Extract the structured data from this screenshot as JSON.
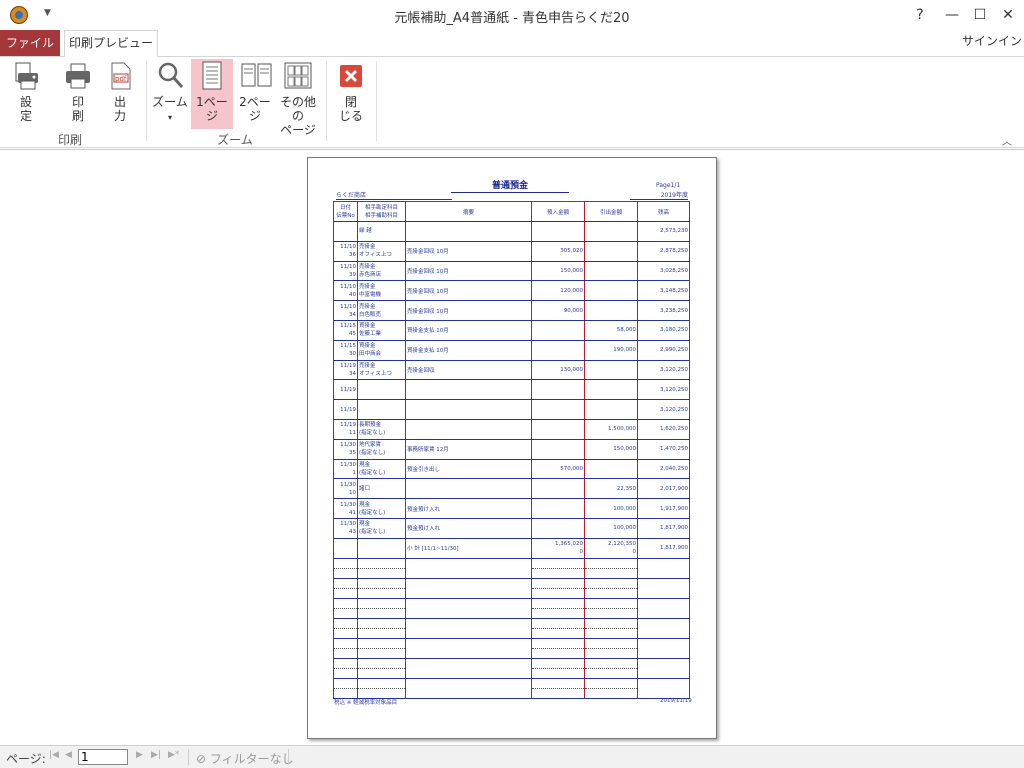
{
  "window": {
    "title": "元帳補助_A4普通紙 - 青色申告らくだ20",
    "help": "?",
    "minimize": "—",
    "maximize": "☐",
    "close": "✕"
  },
  "tabs": {
    "file": "ファイル",
    "print_preview": "印刷プレビュー",
    "signin": "サインイン"
  },
  "ribbon": {
    "settings": "設\n定",
    "print": "印\n刷",
    "output": "出\n力",
    "zoom": "ズーム",
    "page1": "1ペー\nジ",
    "page2": "2ペー\nジ",
    "other_pages": "その他の\nページ",
    "close": "閉\nじる",
    "group_print": "印刷",
    "group_zoom": "ズーム"
  },
  "document": {
    "title": "普通預金",
    "page": "Page1/1",
    "company": "らくだ商店",
    "year": "2019年度",
    "headers": {
      "date": "日付",
      "ref": "伝票No",
      "acct1": "相手勘定科目",
      "acct2": "相手補助科目",
      "desc": "摘要",
      "debit": "預入金額",
      "credit": "引出金額",
      "balance": "残高"
    },
    "rows": [
      {
        "date": "",
        "no": "",
        "acct": "繰 越",
        "sub": "",
        "desc": "",
        "debit": "",
        "credit": "",
        "balance": "2,573,230"
      },
      {
        "date": "11/10",
        "no": "36",
        "acct": "売掛金",
        "sub": "オフィス上つ",
        "desc": "売掛金回収 10月",
        "debit": "305,020",
        "credit": "",
        "balance": "2,878,250"
      },
      {
        "date": "11/10",
        "no": "39",
        "acct": "売掛金",
        "sub": "赤色商店",
        "desc": "売掛金回収 10月",
        "debit": "150,000",
        "credit": "",
        "balance": "3,028,250"
      },
      {
        "date": "11/10",
        "no": "40",
        "acct": "売掛金",
        "sub": "中富電機",
        "desc": "売掛金回収 10月",
        "debit": "120,000",
        "credit": "",
        "balance": "3,148,250"
      },
      {
        "date": "11/10",
        "no": "34",
        "acct": "売掛金",
        "sub": "白色販売",
        "desc": "売掛金回収 10月",
        "debit": "90,000",
        "credit": "",
        "balance": "3,238,250"
      },
      {
        "date": "11/15",
        "no": "45",
        "acct": "買掛金",
        "sub": "佐藤工業",
        "desc": "買掛金支払 10月",
        "debit": "",
        "credit": "58,000",
        "balance": "3,180,250"
      },
      {
        "date": "11/15",
        "no": "30",
        "acct": "買掛金",
        "sub": "田中商会",
        "desc": "買掛金支払 10月",
        "debit": "",
        "credit": "190,000",
        "balance": "2,990,250"
      },
      {
        "date": "11/19",
        "no": "34",
        "acct": "売掛金",
        "sub": "オフィス上つ",
        "desc": "売掛金回収",
        "debit": "130,000",
        "credit": "",
        "balance": "3,120,250"
      },
      {
        "date": "11/19",
        "no": "",
        "acct": "",
        "sub": "",
        "desc": "",
        "debit": "",
        "credit": "",
        "balance": "3,120,250"
      },
      {
        "date": "11/19",
        "no": "",
        "acct": "",
        "sub": "",
        "desc": "",
        "debit": "",
        "credit": "",
        "balance": "3,120,250"
      },
      {
        "date": "11/19",
        "no": "11",
        "acct": "長期預金",
        "sub": "(指定なし)",
        "desc": "",
        "debit": "",
        "credit": "1,500,000",
        "balance": "1,620,250"
      },
      {
        "date": "11/30",
        "no": "35",
        "acct": "地代家賃",
        "sub": "(指定なし)",
        "desc": "事務所家賃 12月",
        "debit": "",
        "credit": "150,000",
        "balance": "1,470,250"
      },
      {
        "date": "11/30",
        "no": "1",
        "acct": "現金",
        "sub": "(指定なし)",
        "desc": "預金引き出し",
        "debit": "570,000",
        "credit": "",
        "balance": "2,040,250"
      },
      {
        "date": "11/30",
        "no": "10",
        "acct": "諸口",
        "sub": "",
        "desc": "",
        "debit": "",
        "credit": "22,350",
        "balance": "2,017,900"
      },
      {
        "date": "11/30",
        "no": "41",
        "acct": "現金",
        "sub": "(指定なし)",
        "desc": "預金預け入れ",
        "debit": "",
        "credit": "100,000",
        "balance": "1,917,900"
      },
      {
        "date": "11/30",
        "no": "43",
        "acct": "現金",
        "sub": "(指定なし)",
        "desc": "預金預け入れ",
        "debit": "",
        "credit": "100,000",
        "balance": "1,817,900"
      },
      {
        "date": "",
        "no": "",
        "acct": "",
        "sub": "",
        "desc": "小 計 [11/1~11/30]",
        "debit": "1,365,020",
        "debit2": "0",
        "credit": "2,120,350",
        "credit2": "0",
        "balance": "1,817,900"
      }
    ],
    "footer_left": "税込 ※ 軽減税率対象品目",
    "footer_right": "2019/11/19"
  },
  "statusbar": {
    "page_label": "ページ:",
    "page_value": "1",
    "filter": "フィルターなし"
  }
}
